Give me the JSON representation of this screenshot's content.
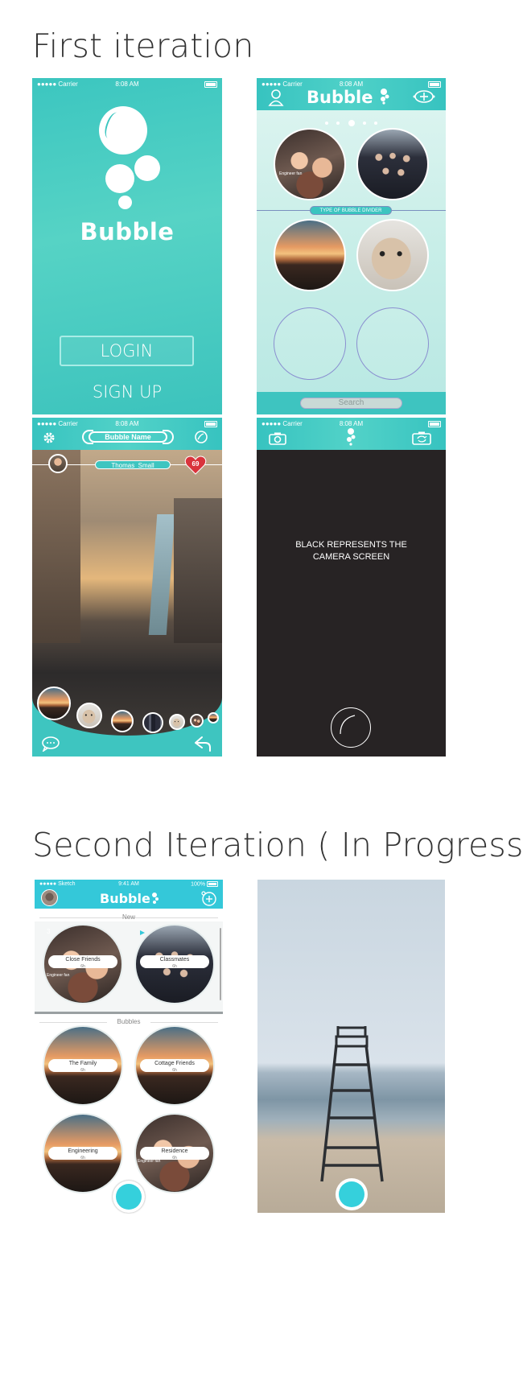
{
  "headings": {
    "first": "First iteration",
    "second": "Second Iteration ( In Progress)"
  },
  "status_bar": {
    "carrier": "●●●●● Carrier",
    "time": "8:08 AM",
    "sketch_carrier": "●●●●● Sketch",
    "sketch_time": "9:41 AM",
    "sketch_battery": "100%"
  },
  "login_screen": {
    "app_name": "Bubble",
    "login_label": "LOGIN",
    "signup_label": "SIGN UP"
  },
  "bubbles_screen": {
    "app_name": "Bubble",
    "divider_label": "TYPE OF BUBBLE DIVIDER",
    "search_placeholder": "Search",
    "caption_engineer": "Engineer fan",
    "page_dots": 5,
    "active_dot": 3
  },
  "bubble_view_screen": {
    "title": "Bubble Name",
    "username": "Thomas_Small",
    "heart_count": "69"
  },
  "camera_screen": {
    "message_line1": "BLACK REPRESENTS THE",
    "message_line2": "CAMERA SCREEN"
  },
  "v2_list_screen": {
    "app_name": "Bubble",
    "section_new": "New",
    "section_bubbles": "Bubbles",
    "new_count": "3",
    "cards": [
      {
        "title": "Close Friends",
        "time": "6h",
        "caption": "Engineer fan"
      },
      {
        "title": "Classmates",
        "time": "6h",
        "caption": ""
      },
      {
        "title": "The Family",
        "time": "6h",
        "caption": ""
      },
      {
        "title": "Cottage Friends",
        "time": "6h",
        "caption": ""
      },
      {
        "title": "Engineering",
        "time": "6h",
        "caption": ""
      },
      {
        "title": "Residence",
        "time": "6h",
        "caption": "Engineer fan"
      }
    ]
  },
  "colors": {
    "teal": "#3cc6c2",
    "teal_dark": "#2fb0b0",
    "heart_red": "#d9343c",
    "camera_black": "#272324"
  }
}
